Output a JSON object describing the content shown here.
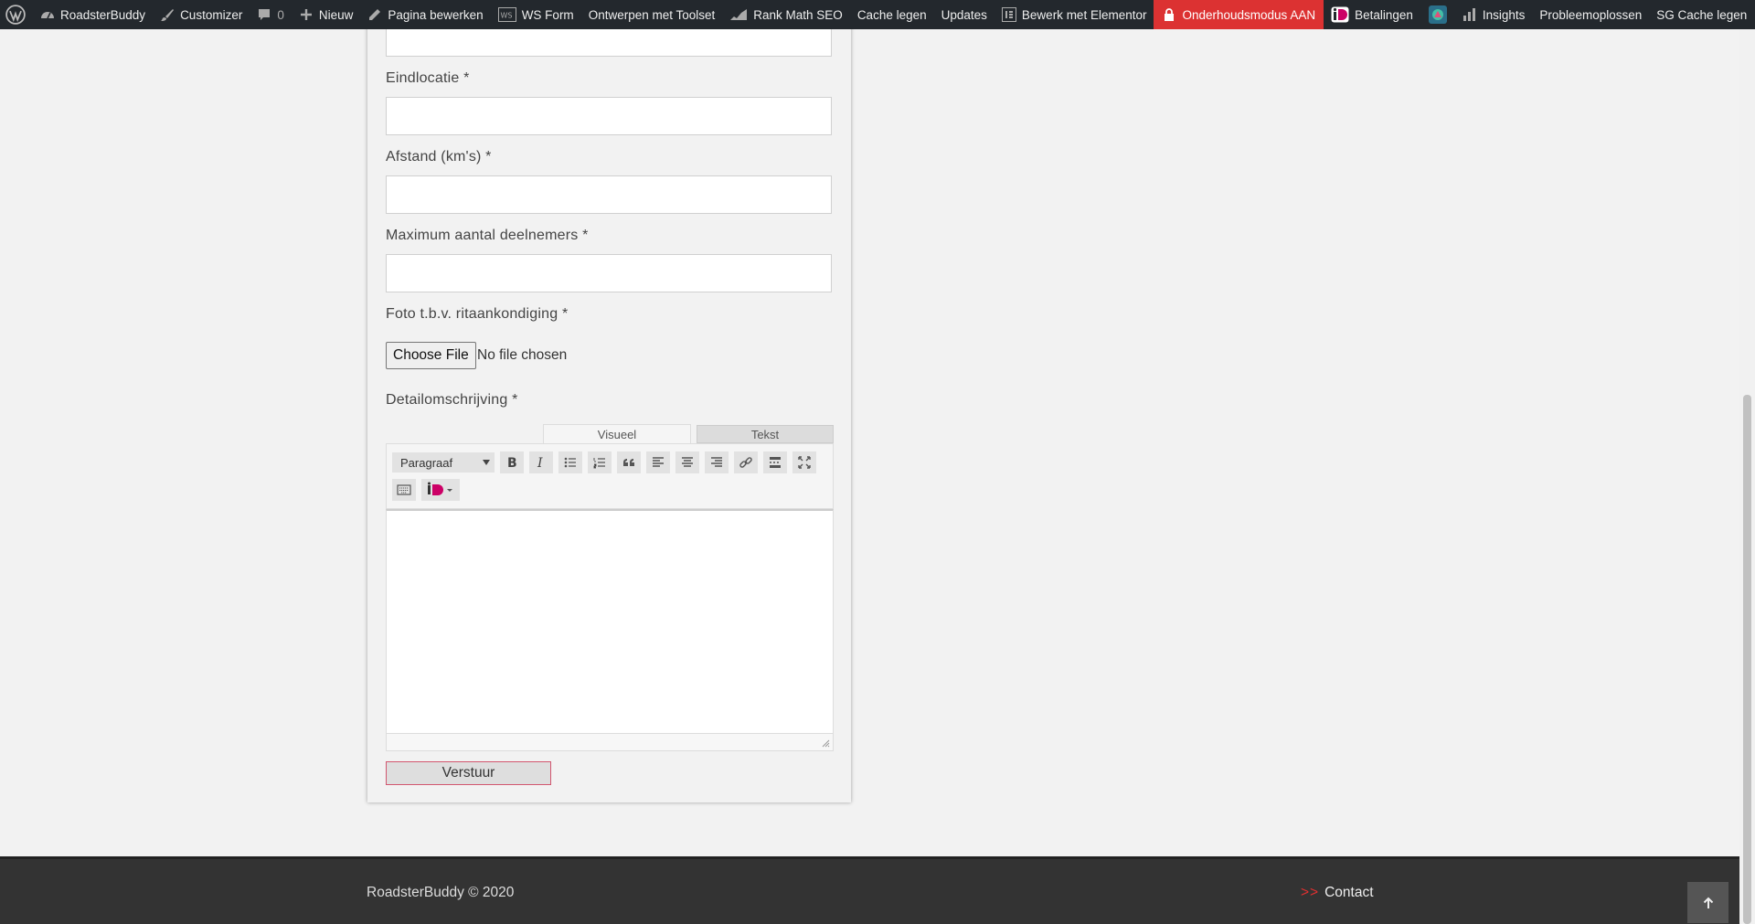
{
  "adminbar": {
    "items": [
      {
        "label": "",
        "icon": "wordpress-logo-icon"
      },
      {
        "label": "RoadsterBuddy",
        "icon": "dashboard-icon"
      },
      {
        "label": "Customizer",
        "icon": "brush-icon"
      },
      {
        "label": "0",
        "icon": "comment-icon"
      },
      {
        "label": "Nieuw",
        "icon": "plus-icon"
      },
      {
        "label": "Pagina bewerken",
        "icon": "pencil-icon"
      },
      {
        "label": "WS Form",
        "icon": "ws-form-icon"
      },
      {
        "label": "Ontwerpen met Toolset",
        "icon": ""
      },
      {
        "label": "Rank Math SEO",
        "icon": "rank-math-icon"
      },
      {
        "label": "Cache legen",
        "icon": ""
      },
      {
        "label": "Updates",
        "icon": ""
      },
      {
        "label": "Bewerk met Elementor",
        "icon": "elementor-icon"
      },
      {
        "label": "Onderhoudsmodus AAN",
        "icon": "lock-icon"
      },
      {
        "label": "Betalingen",
        "icon": "ideal-icon"
      },
      {
        "label": "",
        "icon": "plugin-icon"
      },
      {
        "label": "Insights",
        "icon": "bar-chart-icon"
      },
      {
        "label": "Probleemoplossen",
        "icon": ""
      },
      {
        "label": "SG Cache legen",
        "icon": ""
      }
    ]
  },
  "form": {
    "fields": [
      {
        "label": "Eindlocatie *",
        "value": ""
      },
      {
        "label": "Afstand (km's) *",
        "value": ""
      },
      {
        "label": "Maximum aantal deelnemers *",
        "value": ""
      }
    ],
    "photo": {
      "label": "Foto t.b.v. ritaankondiging *",
      "button": "Choose File",
      "status": "No file chosen"
    },
    "description": {
      "label": "Detailomschrijving *",
      "tab_visual": "Visueel",
      "tab_text": "Tekst",
      "format": "Paragraaf",
      "content": ""
    },
    "submit": "Verstuur"
  },
  "footer": {
    "copyright": "RoadsterBuddy © 2020",
    "contact_arrows": ">>",
    "contact": "Contact"
  },
  "colors": {
    "adminbar_bg": "#23282d",
    "maintenance_red": "#dc3232",
    "submit_border": "#d2566f",
    "footer_bg": "#333333",
    "accent_red": "#e03030"
  }
}
